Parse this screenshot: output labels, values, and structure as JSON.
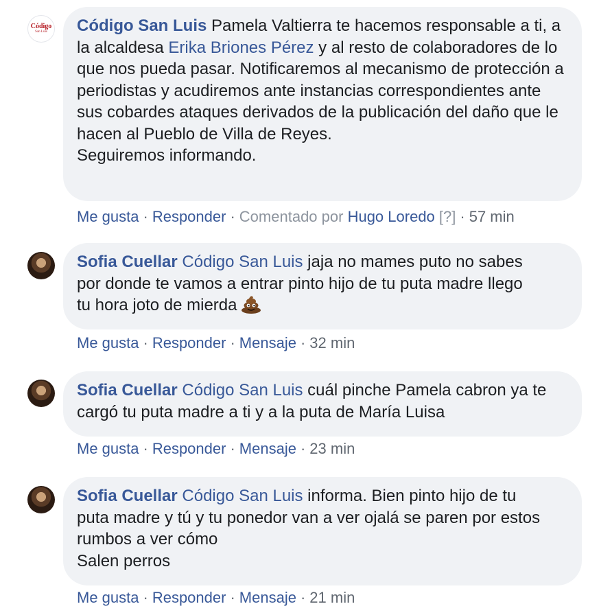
{
  "comments": [
    {
      "author": "Código San Luis",
      "avatar": "codigo-san-luis-logo",
      "logo_text": "Código",
      "logo_subtext": "San Luis",
      "text_before": "Pamela Valtierra te hacemos responsable a ti, a la alcaldesa ",
      "mention": "Erika Briones Pérez",
      "text_after": " y al resto de colaboradores de lo que nos pueda pasar. Notificaremos al mecanismo de protección a periodistas y acudiremos ante instancias correspondientes ante sus cobardes ataques derivados de la publicación del daño que le hacen al Pueblo de Villa de Reyes.\nSeguiremos informando.",
      "like_label": "Me gusta",
      "reply_label": "Responder",
      "commented_by_label": "Comentado por",
      "commented_by_name": "Hugo Loredo",
      "help_label": "[?]",
      "time": "57 min"
    },
    {
      "author": "Sofia Cuellar",
      "avatar": "sofia-cuellar-photo",
      "mention": "Código San Luis",
      "text": " jaja no mames puto no sabes por donde te vamos a entrar pinto hijo de tu puta madre llego tu hora joto de mierda",
      "emoji": "pile-of-poo-icon",
      "like_label": "Me gusta",
      "reply_label": "Responder",
      "message_label": "Mensaje",
      "time": "32 min"
    },
    {
      "author": "Sofia Cuellar",
      "avatar": "sofia-cuellar-photo",
      "mention": "Código San Luis",
      "text": " cuál pinche Pamela cabron ya te cargó tu puta madre a ti y a la puta de María Luisa",
      "like_label": "Me gusta",
      "reply_label": "Responder",
      "message_label": "Mensaje",
      "time": "23 min"
    },
    {
      "author": "Sofia Cuellar",
      "avatar": "sofia-cuellar-photo",
      "mention": "Código San Luis",
      "text": " informa. Bien pinto hijo de tu puta madre y tú y tu ponedor van a ver ojalá se paren por estos rumbos a ver cómo\nSalen perros",
      "like_label": "Me gusta",
      "reply_label": "Responder",
      "message_label": "Mensaje",
      "time": "21 min"
    }
  ],
  "colors": {
    "link": "#385898",
    "bubble": "#f0f2f5",
    "text": "#1c1e21",
    "meta": "#606770"
  }
}
